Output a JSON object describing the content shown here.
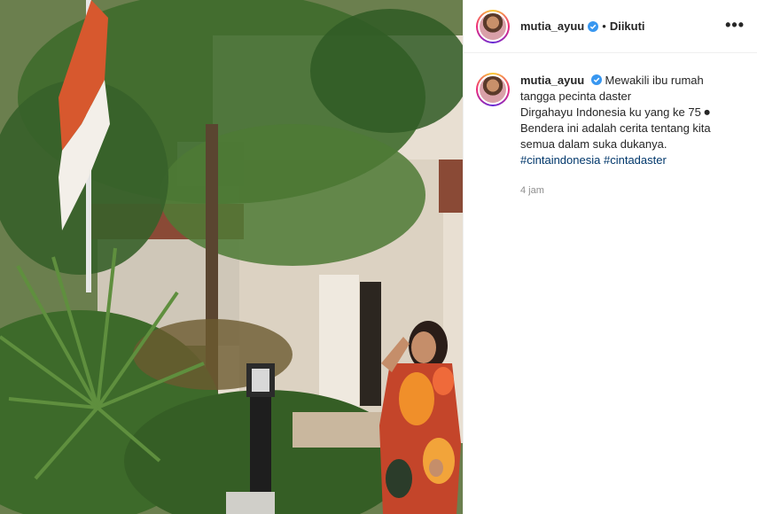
{
  "post": {
    "username": "mutia_ayuu",
    "follow_status": "Diikuti",
    "separator": "•",
    "more_label": "•••",
    "caption_lines": [
      "Mewakili ibu rumah",
      "tangga pecinta daster",
      "Dirgahayu Indonesia ku yang ke 75 ⏺",
      "Bendera ini adalah cerita tentang kita",
      "semua dalam suka dukanya."
    ],
    "hashtags": [
      "#cintaindonesia",
      "#cintadaster"
    ],
    "timestamp": "4 jam"
  },
  "colors": {
    "verified": "#3897f0",
    "hashtag": "#00376b",
    "muted": "#8e8e8e"
  },
  "icons": {
    "verified": "verified-badge-icon",
    "more": "more-options-icon"
  }
}
